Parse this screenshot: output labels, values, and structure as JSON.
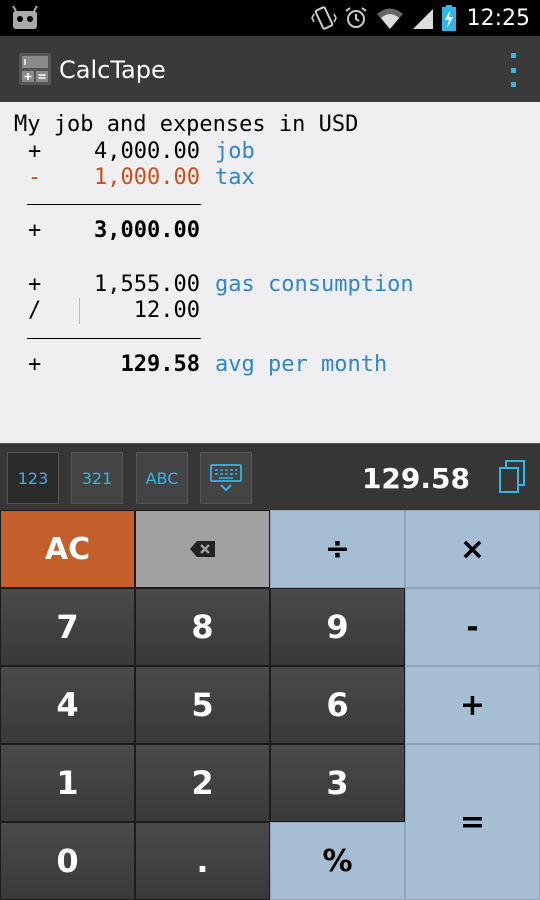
{
  "status": {
    "time": "12:25"
  },
  "app": {
    "title": "CalcTape"
  },
  "tape": {
    "heading": "My job and expenses in USD",
    "lines": [
      {
        "op": "+",
        "value": "4,000.00",
        "note": "job"
      },
      {
        "op": "-",
        "value": "1,000.00",
        "note": "tax"
      },
      {
        "op": "+",
        "value": "3,000.00",
        "note": ""
      },
      {
        "op": "+",
        "value": "1,555.00",
        "note": "gas consumption"
      },
      {
        "op": "/",
        "value": "12.00",
        "note": ""
      },
      {
        "op": "+",
        "value": "129.58",
        "note": "avg per month"
      }
    ]
  },
  "toolbar": {
    "modes": [
      "123",
      "321",
      "ABC"
    ],
    "result": "129.58"
  },
  "keys": {
    "ac": "AC",
    "divide": "÷",
    "multiply": "×",
    "minus": "-",
    "plus": "+",
    "equals": "=",
    "percent": "%",
    "dot": ".",
    "digits": [
      "0",
      "1",
      "2",
      "3",
      "4",
      "5",
      "6",
      "7",
      "8",
      "9"
    ]
  },
  "colors": {
    "accent": "#33b5e5",
    "note": "#2f87c8",
    "negative": "#c8501e",
    "ac": "#c45e2a",
    "operator": "#a6bed4"
  }
}
